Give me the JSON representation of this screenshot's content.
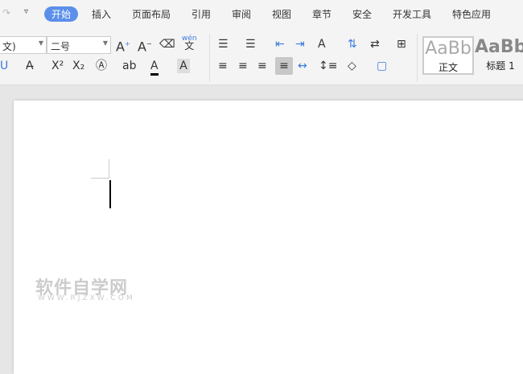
{
  "menu": {
    "tabs": [
      "开始",
      "插入",
      "页面布局",
      "引用",
      "审阅",
      "视图",
      "章节",
      "安全",
      "开发工具",
      "特色应用"
    ]
  },
  "toolbar": {
    "font_name": "文)",
    "font_size": "二号",
    "styles": [
      {
        "preview": "AaBb",
        "label": "正文"
      },
      {
        "preview": "AaBb",
        "label": "标题 1"
      }
    ],
    "pinyin_label": "wén"
  },
  "watermark": {
    "title": "软件自学网",
    "url": "WWW.RJZXW.COM"
  }
}
